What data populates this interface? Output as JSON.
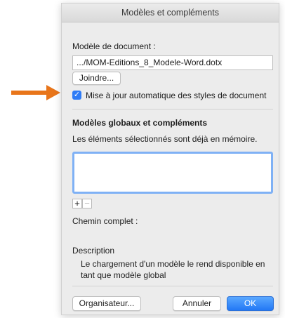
{
  "dialog": {
    "title": "Modèles et compléments",
    "template_label": "Modèle de document :",
    "template_value": ".../MOM-Editions_8_Modele-Word.dotx",
    "attach_label": "Joindre...",
    "auto_update_label": "Mise à jour automatique des styles de document",
    "auto_update_checked": true,
    "global_heading": "Modèles globaux et compléments",
    "global_info": "Les éléments sélectionnés sont déjà en mémoire.",
    "global_items": [],
    "plus_label": "+",
    "minus_label": "−",
    "full_path_label": "Chemin complet :",
    "description_label": "Description",
    "description_text": "Le chargement d'un modèle le rend disponible en tant que modèle global",
    "organizer_label": "Organisateur...",
    "cancel_label": "Annuler",
    "ok_label": "OK"
  },
  "colors": {
    "annotation_arrow": "#e8751a",
    "accent": "#2f7cf6"
  },
  "icons": {
    "annotation": "arrow-right-icon",
    "checkbox": "checkmark-icon"
  }
}
